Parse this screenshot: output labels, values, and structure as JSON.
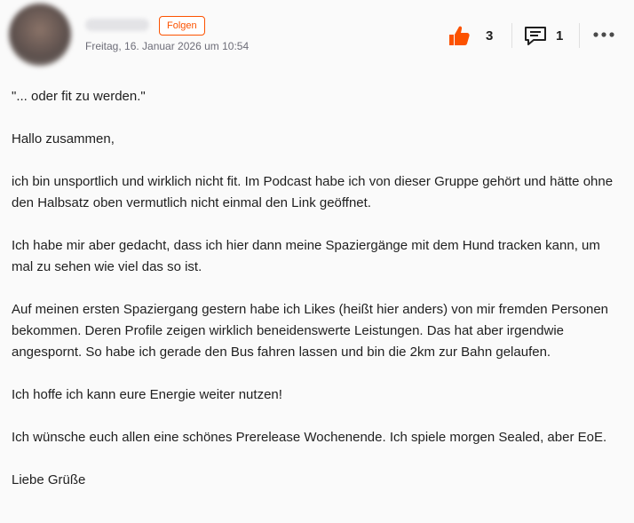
{
  "header": {
    "follow_label": "Folgen",
    "timestamp": "Freitag, 16. Januar 2026 um 10:54"
  },
  "actions": {
    "kudos_count": "3",
    "comment_count": "1",
    "kudos_icon": "thumbs-up-icon",
    "comment_icon": "comment-icon",
    "more_icon": "more-icon"
  },
  "colors": {
    "accent": "#fc5200",
    "text": "#1f1f1f",
    "muted": "#6d6d78"
  },
  "post": {
    "paragraphs": [
      "\"... oder fit zu werden.\"",
      "Hallo zusammen,",
      "ich bin unsportlich und wirklich nicht fit. Im Podcast habe ich von dieser Gruppe gehört und hätte ohne den Halbsatz oben vermutlich nicht einmal den Link geöffnet.",
      "Ich habe mir aber gedacht, dass ich hier dann meine Spaziergänge mit dem Hund tracken kann, um mal zu sehen wie viel das so ist.",
      "Auf meinen ersten Spaziergang gestern habe ich Likes (heißt hier anders) von mir fremden Personen bekommen. Deren Profile zeigen wirklich beneidenswerte Leistungen. Das hat aber irgendwie angespornt. So habe ich gerade den Bus fahren lassen und bin die 2km zur Bahn gelaufen.",
      "Ich hoffe ich kann eure Energie weiter nutzen!",
      "Ich wünsche euch allen eine schönes Prerelease Wochenende. Ich spiele morgen Sealed, aber EoE.",
      "Liebe Grüße"
    ]
  }
}
